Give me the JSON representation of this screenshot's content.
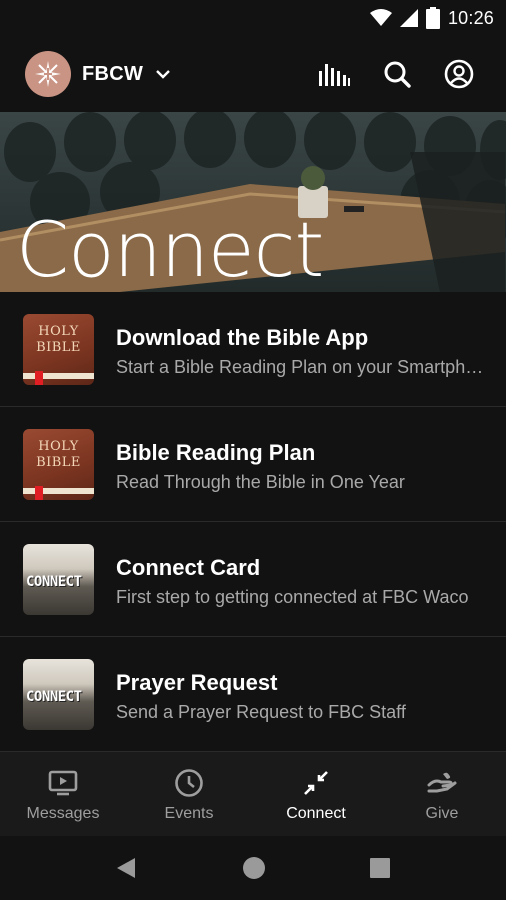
{
  "status_bar": {
    "time": "10:26"
  },
  "header": {
    "org_name": "FBCW",
    "icons": [
      "logo-icon",
      "chevron-down-icon",
      "audio-bars-icon",
      "search-icon",
      "account-icon"
    ]
  },
  "hero": {
    "title": "Connect"
  },
  "items": [
    {
      "title": "Download the Bible App",
      "subtitle": "Start a Bible Reading Plan on your Smartphone",
      "thumb": "bible",
      "thumb_text": [
        "HOLY",
        "BIBLE"
      ]
    },
    {
      "title": "Bible Reading Plan",
      "subtitle": "Read Through the Bible in One Year",
      "thumb": "bible",
      "thumb_text": [
        "HOLY",
        "BIBLE"
      ]
    },
    {
      "title": "Connect Card",
      "subtitle": "First step to getting connected at FBC Waco",
      "thumb": "photo",
      "thumb_text": [
        "CONNECT"
      ]
    },
    {
      "title": "Prayer Request",
      "subtitle": "Send a Prayer Request to FBC Staff",
      "thumb": "photo",
      "thumb_text": [
        "CONNECT"
      ]
    }
  ],
  "bottom_nav": [
    {
      "label": "Messages",
      "icon": "tv-play-icon",
      "active": false
    },
    {
      "label": "Events",
      "icon": "clock-icon",
      "active": false
    },
    {
      "label": "Connect",
      "icon": "arrows-in-icon",
      "active": true
    },
    {
      "label": "Give",
      "icon": "hand-give-icon",
      "active": false
    }
  ],
  "colors": {
    "background": "#121212",
    "logo": "#c99484",
    "subtitle": "#a9a9a9",
    "inactive_nav": "#9e9e9e"
  }
}
